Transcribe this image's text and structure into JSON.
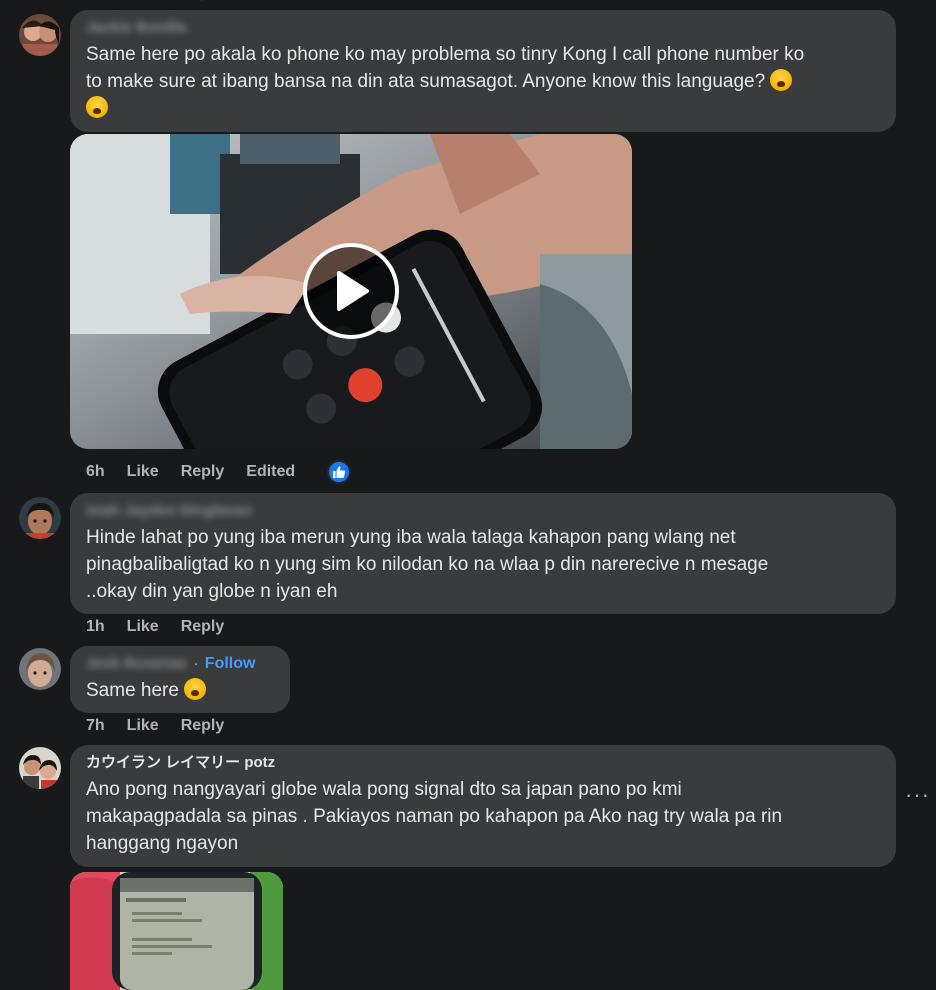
{
  "comments": [
    {
      "author": "Jackie Bonilla",
      "text_line1": "Same here po akala ko phone ko may problema so tinry Kong I call phone number ko",
      "text_line2": "to make sure at ibang bansa na din ata sumasagot. Anyone know this language?",
      "time": "6h",
      "like": "Like",
      "reply": "Reply",
      "edited": "Edited"
    },
    {
      "author": "Isiah Jayden Dinglasan",
      "text_line1": "Hinde lahat po yung iba merun yung iba wala talaga kahapon pang wlang net",
      "text_line2": "pinagbalibaligtad ko n yung sim ko nilodan ko na wlaa p din narerecive n mesage",
      "text_line3": "..okay din yan globe n iyan eh",
      "time": "1h",
      "like": "Like",
      "reply": "Reply"
    },
    {
      "author": "Jesh Rosenas",
      "separator": "·",
      "follow": "Follow",
      "text": "Same here",
      "time": "7h",
      "like": "Like",
      "reply": "Reply"
    },
    {
      "author": "カウイラン レイマリー potz",
      "text_line1": "Ano pong nangyayari globe wala pong signal dto sa japan pano po kmi",
      "text_line2": "makapagpadala sa pinas . Pakiayos naman po kahapon pa Ako nag try wala pa rin",
      "text_line3": "hanggang ngayon"
    }
  ],
  "more_label": "···",
  "icons": {
    "play": "play-icon",
    "like_reaction": "thumbs-up-icon",
    "emoji_crying": "crying-face-emoji",
    "emoji_laughing": "rolling-laughing-emoji",
    "more": "more-options-icon"
  },
  "colors": {
    "background": "#18191a",
    "bubble": "#3a3b3c",
    "meta": "#b0b3b8",
    "link": "#4599ff",
    "like": "#1877f2"
  }
}
